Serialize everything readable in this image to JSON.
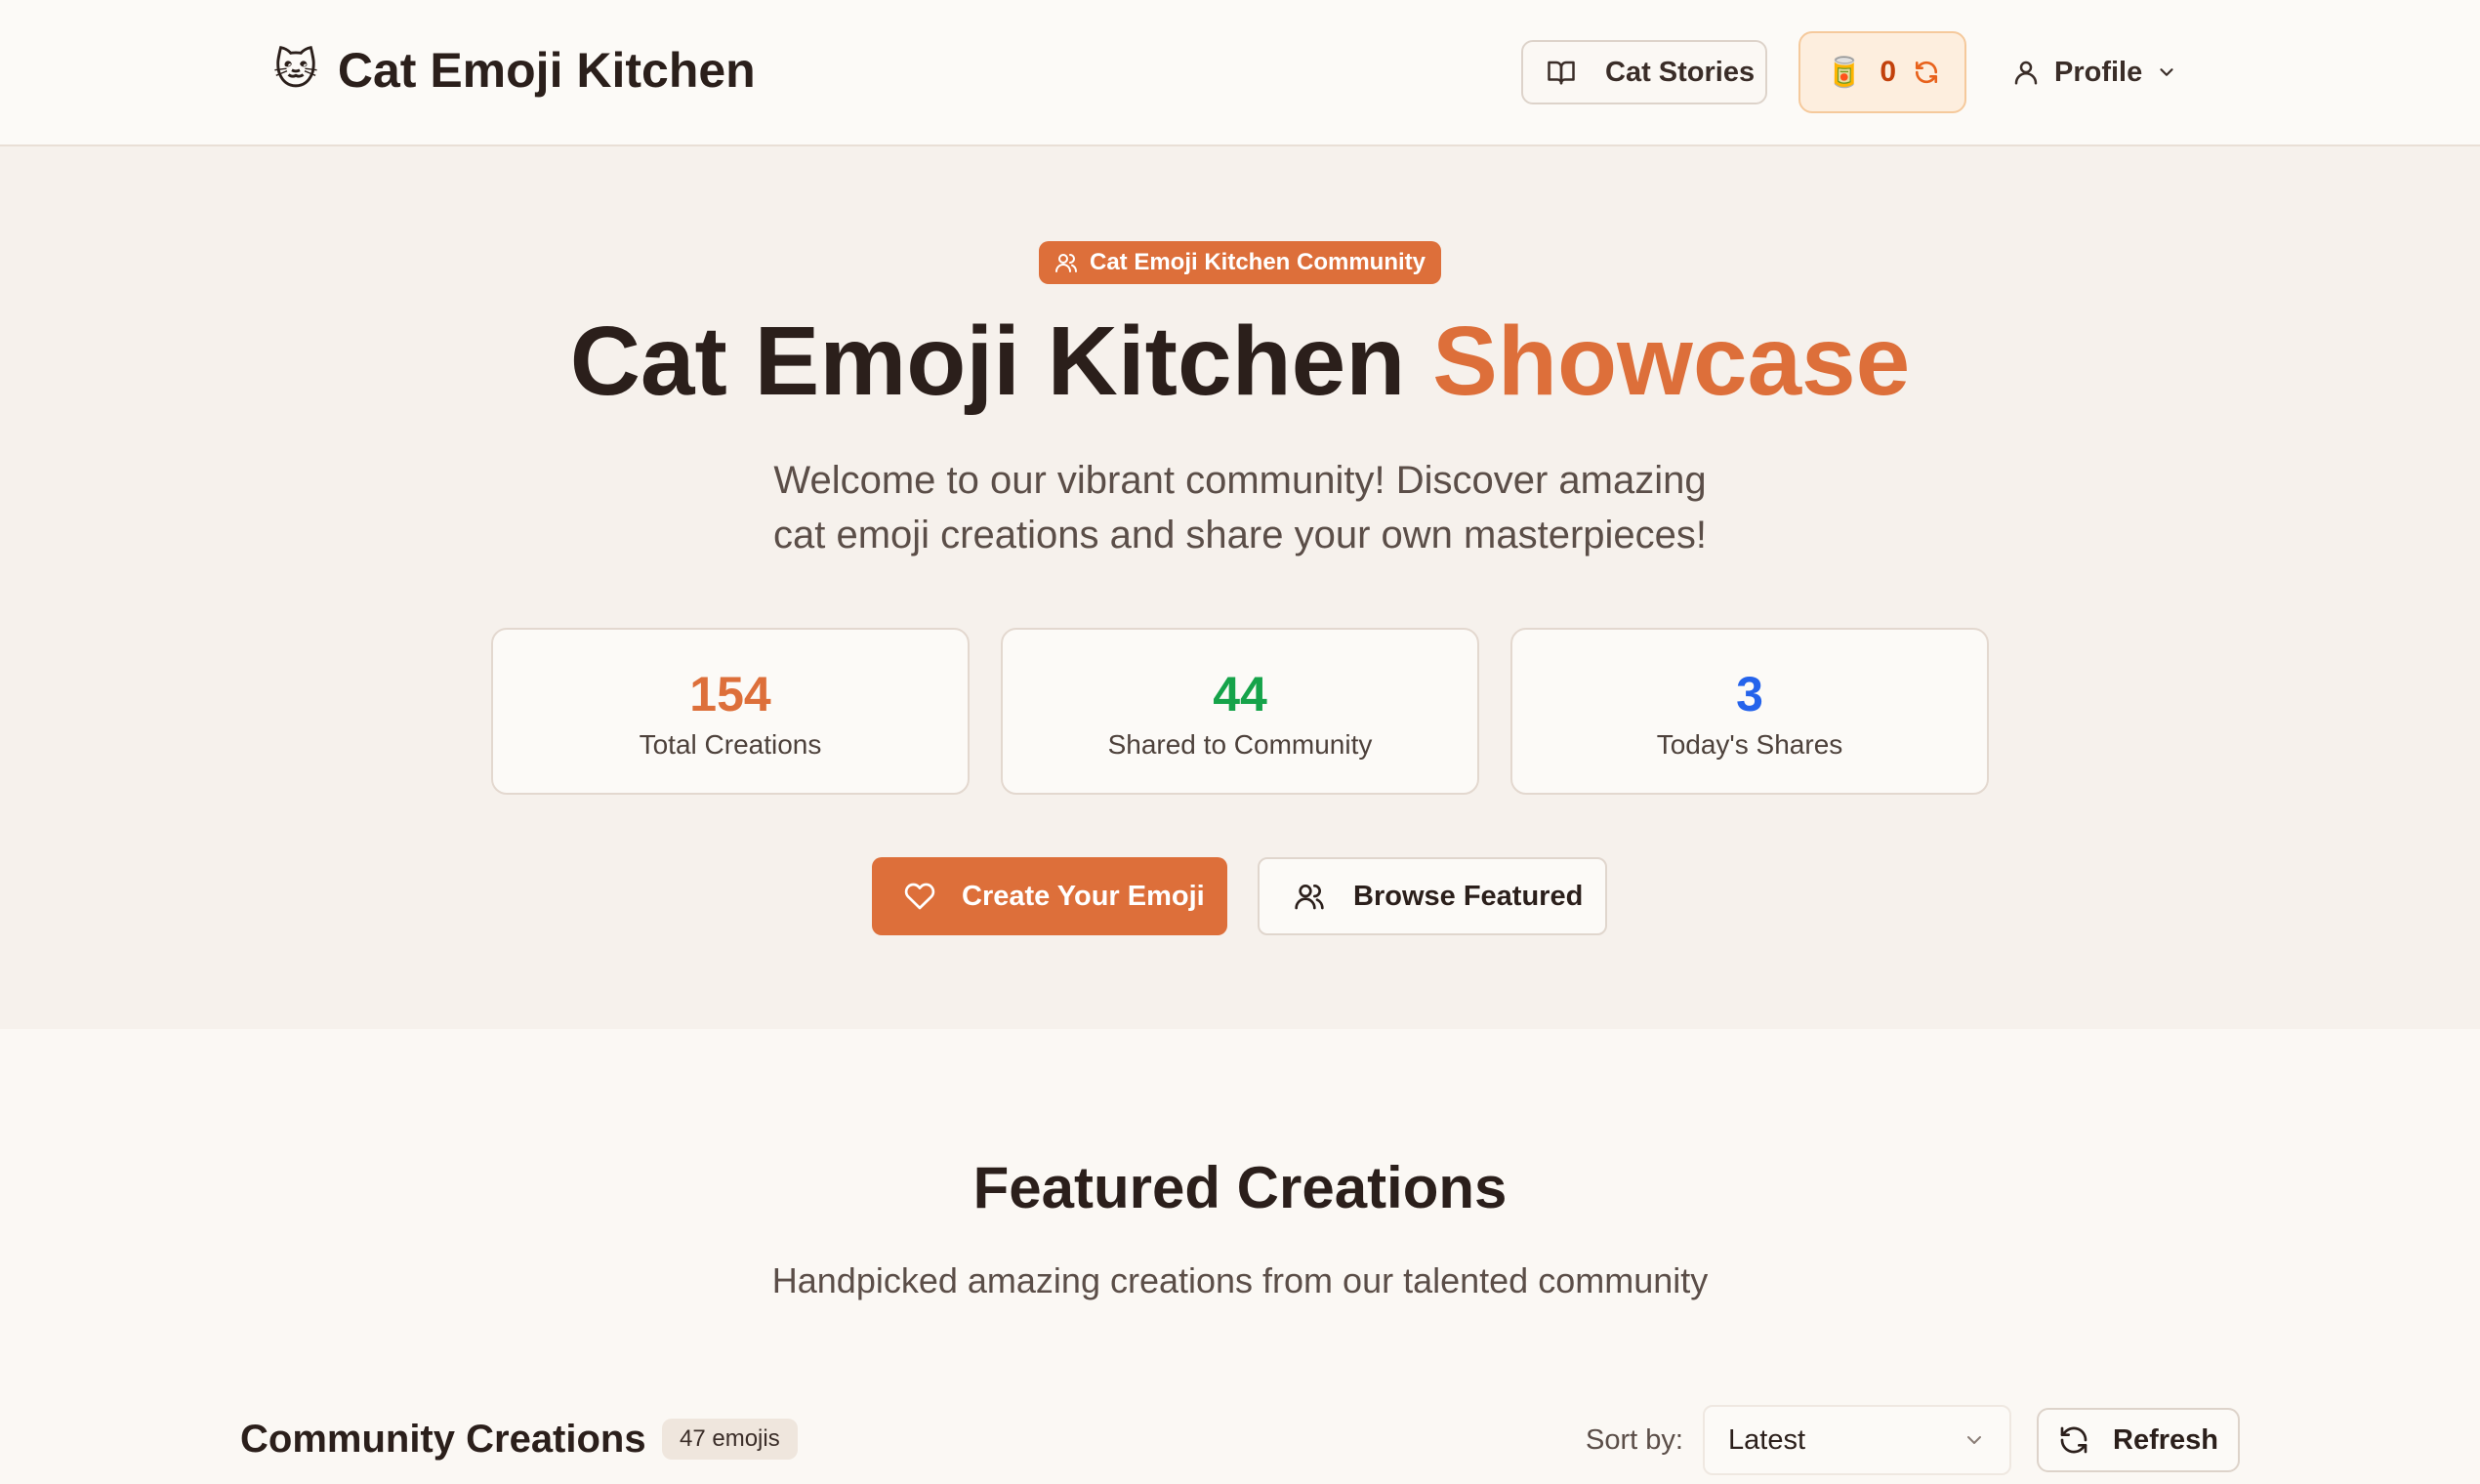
{
  "header": {
    "logo_emoji": "🐱",
    "app_title": "Cat Emoji Kitchen",
    "stories_label": "Cat Stories",
    "coins_emoji": "🥫",
    "coins_value": "0",
    "profile_label": "Profile"
  },
  "hero": {
    "badge_label": "Cat Emoji Kitchen Community",
    "title_main": "Cat Emoji Kitchen",
    "title_accent": "Showcase",
    "subtitle_line1": "Welcome to our vibrant community! Discover amazing",
    "subtitle_line2": "cat emoji creations and share your own masterpieces!",
    "stats": [
      {
        "value": "154",
        "label": "Total Creations",
        "color": "#dd6f3a"
      },
      {
        "value": "44",
        "label": "Shared to Community",
        "color": "#16a34a"
      },
      {
        "value": "3",
        "label": "Today's Shares",
        "color": "#2563eb"
      }
    ],
    "create_label": "Create Your Emoji",
    "browse_label": "Browse Featured"
  },
  "featured": {
    "title": "Featured Creations",
    "subtitle": "Handpicked amazing creations from our talented community"
  },
  "community": {
    "title": "Community Creations",
    "count_label": "47 emojis",
    "sort_label": "Sort by:",
    "sort_value": "Latest",
    "refresh_label": "Refresh"
  },
  "colors": {
    "accent": "#dd6f3a",
    "background": "#fbf8f4",
    "hero_background": "#f6f1ec"
  }
}
